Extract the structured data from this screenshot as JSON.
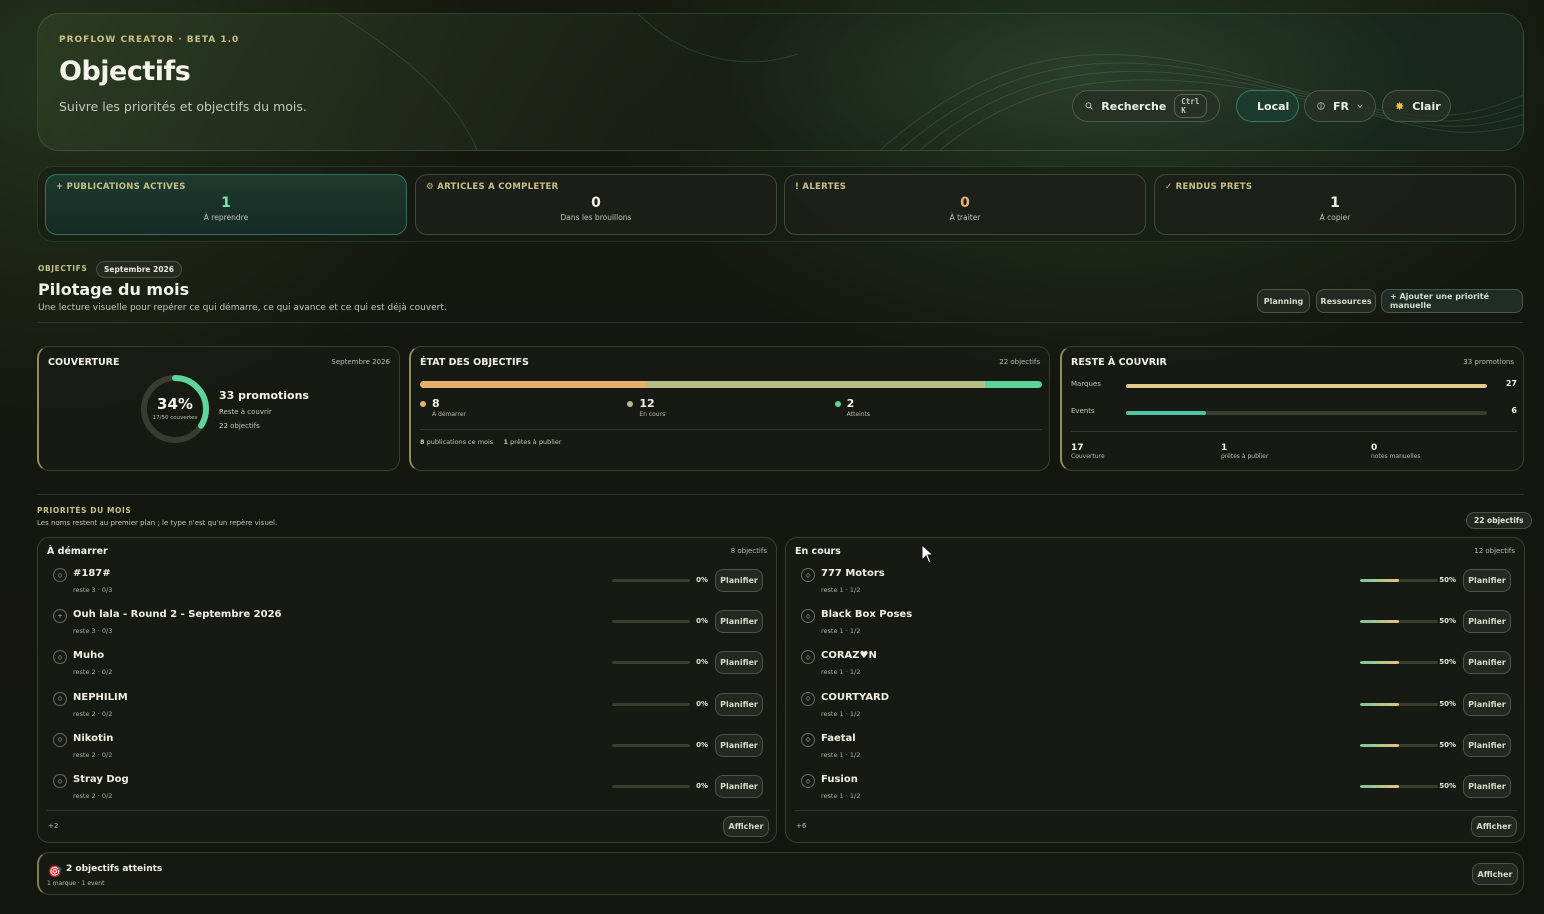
{
  "header": {
    "eyebrow": "PROFLOW CREATOR · BETA 1.0",
    "title": "Objectifs",
    "subtitle": "Suivre les priorités et objectifs du mois.",
    "search_label": "Recherche",
    "search_shortcut": "Ctrl K",
    "local_label": "Local",
    "lang_label": "FR",
    "theme_label": "Clair"
  },
  "stats": [
    {
      "label": "+ PUBLICATIONS ACTIVES",
      "value": "1",
      "caption": "À reprendre"
    },
    {
      "label": "ARTICLES A COMPLETER",
      "value": "0",
      "caption": "Dans les brouillons"
    },
    {
      "label": "! ALERTES",
      "value": "0",
      "caption": "À traiter"
    },
    {
      "label": "✓ RENDUS PRETS",
      "value": "1",
      "caption": "À copier"
    }
  ],
  "objectives": {
    "eyebrow": "OBJECTIFS",
    "month_chip": "Septembre 2026",
    "title": "Pilotage du mois",
    "subtitle": "Une lecture visuelle pour repérer ce qui démarre, ce qui avance et ce qui est déjà couvert.",
    "planning_label": "Planning",
    "resources_label": "Ressources",
    "add_priority_label": "+ Ajouter une priorité manuelle"
  },
  "coverage": {
    "title": "COUVERTURE",
    "month": "Septembre 2026",
    "percent": "34%",
    "ratio": "17/50 couvertes",
    "progress": 0.34,
    "promotions": "33 promotions",
    "remaining": "Reste à couvrir",
    "objectives": "22 objectifs"
  },
  "state": {
    "title": "ÉTAT DES OBJECTIFS",
    "meta": "22 objectifs",
    "segments": [
      {
        "value": 8,
        "label": "À démarrer",
        "color": "#e8b06e"
      },
      {
        "value": 12,
        "label": "En cours",
        "color": "#b7bd84"
      },
      {
        "value": 2,
        "label": "Atteints",
        "color": "#5ed49a"
      }
    ],
    "footer_pub_count": "8",
    "footer_pub_label": "publications ce mois",
    "footer_ready_count": "1",
    "footer_ready_label": "prêtes à publier"
  },
  "remaining": {
    "title": "RESTE À COUVRIR",
    "meta": "33 promotions",
    "bars": [
      {
        "label": "Marques",
        "value": 27,
        "max": 27,
        "color": "#e6c98c"
      },
      {
        "label": "Events",
        "value": 6,
        "max": 27,
        "color": "#4dc5a5"
      }
    ],
    "stats": [
      {
        "value": "17",
        "label": "Couverture"
      },
      {
        "value": "1",
        "label": "prêtes à publier"
      },
      {
        "value": "0",
        "label": "notes manuelles"
      }
    ]
  },
  "priorities": {
    "eyebrow": "PRIORITÉS DU MOIS",
    "subtitle": "Les noms restent au premier plan ; le type n'est qu'un repère visuel.",
    "count_chip": "22 objectifs",
    "plan_label": "Planifier",
    "show_label": "Afficher",
    "todo": {
      "title": "À démarrer",
      "meta": "8 objectifs",
      "more": "+2",
      "items": [
        {
          "icon": "◇",
          "name": "#187#",
          "sub": "reste 3 · 0/3",
          "pct": "0%",
          "progress": 0
        },
        {
          "icon": "+",
          "name": "Ouh lala - Round 2 - Septembre 2026",
          "sub": "reste 3 · 0/3",
          "pct": "0%",
          "progress": 0
        },
        {
          "icon": "◇",
          "name": "Muho",
          "sub": "reste 2 · 0/2",
          "pct": "0%",
          "progress": 0
        },
        {
          "icon": "◇",
          "name": "NEPHILIM",
          "sub": "reste 2 · 0/2",
          "pct": "0%",
          "progress": 0
        },
        {
          "icon": "◇",
          "name": "Nikotin",
          "sub": "reste 2 · 0/2",
          "pct": "0%",
          "progress": 0
        },
        {
          "icon": "◇",
          "name": "Stray Dog",
          "sub": "reste 2 · 0/2",
          "pct": "0%",
          "progress": 0
        }
      ]
    },
    "doing": {
      "title": "En cours",
      "meta": "12 objectifs",
      "more": "+6",
      "items": [
        {
          "icon": "◇",
          "name": "777 Motors",
          "sub": "reste 1 · 1/2",
          "pct": "50%",
          "progress": 0.5
        },
        {
          "icon": "◇",
          "name": "Black Box Poses",
          "sub": "reste 1 · 1/2",
          "pct": "50%",
          "progress": 0.5
        },
        {
          "icon": "◇",
          "name": "CORAZ♥N",
          "sub": "reste 1 · 1/2",
          "pct": "50%",
          "progress": 0.5
        },
        {
          "icon": "◇",
          "name": "COURTYARD",
          "sub": "reste 1 · 1/2",
          "pct": "50%",
          "progress": 0.5
        },
        {
          "icon": "◇",
          "name": "Faetal",
          "sub": "reste 1 · 1/2",
          "pct": "50%",
          "progress": 0.5
        },
        {
          "icon": "◇",
          "name": "Fusion",
          "sub": "reste 1 · 1/2",
          "pct": "50%",
          "progress": 0.5
        }
      ]
    }
  },
  "achieved": {
    "title": "2 objectifs atteints",
    "sub": "1 marque · 1 event",
    "show_label": "Afficher"
  }
}
